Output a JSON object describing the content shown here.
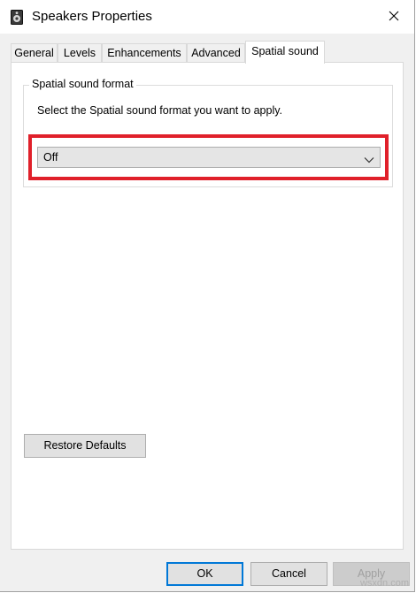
{
  "window": {
    "title": "Speakers Properties",
    "icon": "speaker-icon",
    "close_icon": "close-icon"
  },
  "tabs": [
    {
      "label": "General",
      "active": false
    },
    {
      "label": "Levels",
      "active": false
    },
    {
      "label": "Enhancements",
      "active": false
    },
    {
      "label": "Advanced",
      "active": false
    },
    {
      "label": "Spatial sound",
      "active": true
    }
  ],
  "spatial": {
    "group_title": "Spatial sound format",
    "description": "Select the Spatial sound format you want to apply.",
    "format_selected": "Off",
    "highlight_color": "#e0202a"
  },
  "buttons": {
    "restore_defaults": "Restore Defaults",
    "ok": "OK",
    "cancel": "Cancel",
    "apply": "Apply"
  },
  "watermark": "wsxdn.com",
  "colors": {
    "focus_border": "#0078d7",
    "dialog_bg": "#f0f0f0"
  }
}
